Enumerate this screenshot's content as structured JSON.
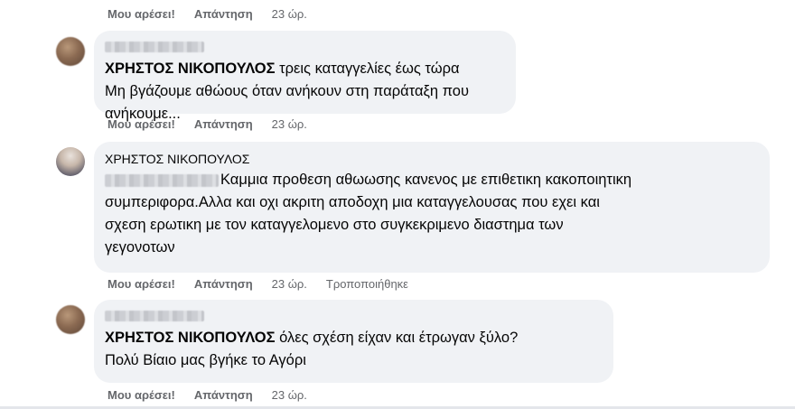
{
  "comments": [
    {
      "actions": {
        "like": "Μου αρέσει!",
        "reply": "Απάντηση",
        "time": "23 ώρ."
      }
    },
    {
      "tagged_name": "ΧΡΗΣΤΟΣ ΝΙΚΟΠΟΥΛΟΣ",
      "text_after_tag": " τρεις καταγγελίες έως τώρα",
      "line2": "Μη βγάζουμε αθώους όταν ανήκουν στη παράταξη που ανήκουμε...",
      "actions": {
        "like": "Μου αρέσει!",
        "reply": "Απάντηση",
        "time": "23 ώρ."
      }
    },
    {
      "author": "ΧΡΗΣΤΟΣ ΝΙΚΟΠΟΥΛΟΣ",
      "line1": "Καμμια προθεση αθωωσης κανενος με επιθετικη κακοποιητικη",
      "line2": "συμπεριφορα.Αλλα και οχι ακριτη αποδοχη μια καταγγελουσας που εχει και",
      "line3": "σχεση ερωτικη με τον καταγγελομενο στο συγκεκριμενο διαστημα των",
      "line4": "γεγονοτων",
      "actions": {
        "like": "Μου αρέσει!",
        "reply": "Απάντηση",
        "time": "23 ώρ.",
        "edited": "Τροποποιήθηκε"
      }
    },
    {
      "tagged_name": "ΧΡΗΣΤΟΣ ΝΙΚΟΠΟΥΛΟΣ",
      "text_after_tag": " όλες σχέση είχαν και έτρωγαν ξύλο?",
      "line2": "Πολύ Βίαιο μας βγήκε το Αγόρι",
      "actions": {
        "like": "Μου αρέσει!",
        "reply": "Απάντηση",
        "time": "23 ώρ."
      }
    }
  ],
  "icons": {
    "avatar_blurred": "avatar-blurred-icon",
    "avatar_photo": "avatar-photo-icon"
  }
}
